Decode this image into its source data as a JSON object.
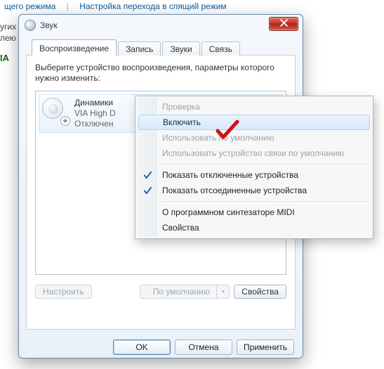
{
  "bg": {
    "link1": "щего режима",
    "link2": "Настройка перехода в спящий режим",
    "side1": "угих",
    "side2": "лею",
    "ia": "IA"
  },
  "window": {
    "title": "Звук"
  },
  "tabs": {
    "playback": "Воспроизведение",
    "recording": "Запись",
    "sounds": "Звуки",
    "communication": "Связь"
  },
  "instruction": "Выберите устройство воспроизведения, параметры которого нужно изменить:",
  "device": {
    "name": "Динамики",
    "vendor": "VIA High D",
    "status": "Отключен"
  },
  "buttons": {
    "configure": "Настроить",
    "set_default": "По умолчанию",
    "properties": "Свойства",
    "ok": "OK",
    "cancel": "Отмена",
    "apply": "Применить"
  },
  "menu": {
    "test": "Проверка",
    "enable": "Включить",
    "set_default": "Использовать по умолчанию",
    "set_comm_default": "Использовать устройство связи по умолчанию",
    "show_disabled": "Показать отключенные устройства",
    "show_disconnected": "Показать отсоединенные устройства",
    "about_synth": "О программном синтезаторе MIDI",
    "properties": "Свойства"
  }
}
